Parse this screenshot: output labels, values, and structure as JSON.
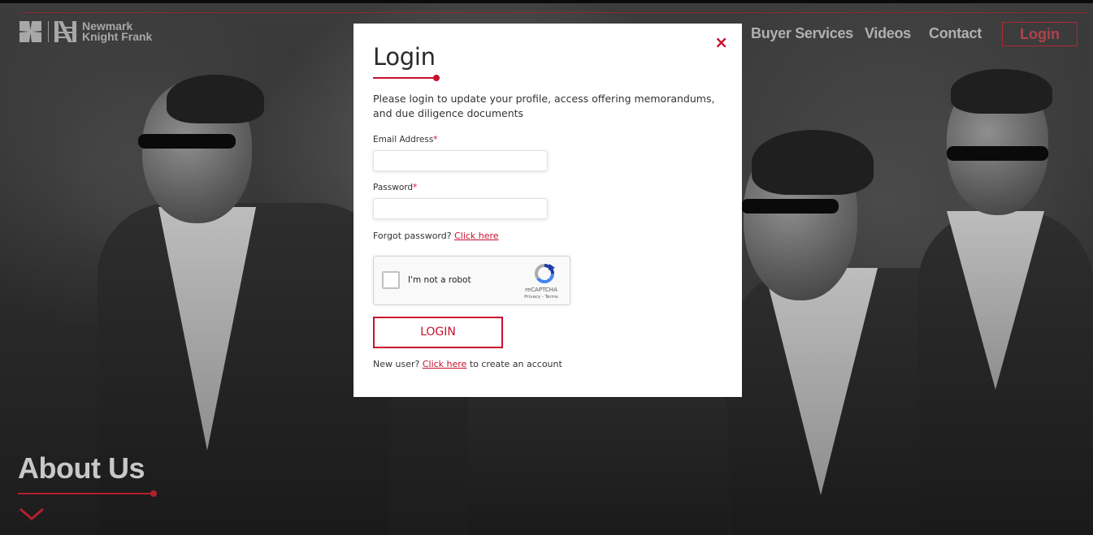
{
  "header": {
    "logo_line1": "Newmark",
    "logo_line2": "Knight Frank",
    "nav": [
      {
        "label": "Buyer Services"
      },
      {
        "label": "Videos"
      },
      {
        "label": "Contact"
      }
    ],
    "login_label": "Login"
  },
  "hero": {
    "title": "About Us"
  },
  "modal": {
    "close_symbol": "×",
    "title": "Login",
    "intro": "Please login to update your profile, access offering memorandums, and due diligence documents",
    "email_label": "Email Address",
    "email_value": "",
    "password_label": "Password",
    "password_value": "",
    "required_mark": "*",
    "forgot_prefix": "Forgot password?",
    "forgot_link": "Click here",
    "recaptcha": {
      "label": "I'm not a robot",
      "brand": "reCAPTCHA",
      "terms": "Privacy - Terms"
    },
    "login_button": "LOGIN",
    "new_user_prefix": "New user?",
    "new_user_link": "Click here",
    "new_user_suffix": "to create an account"
  },
  "colors": {
    "accent": "#c8102e",
    "nav_text": "#b0b0b0"
  }
}
